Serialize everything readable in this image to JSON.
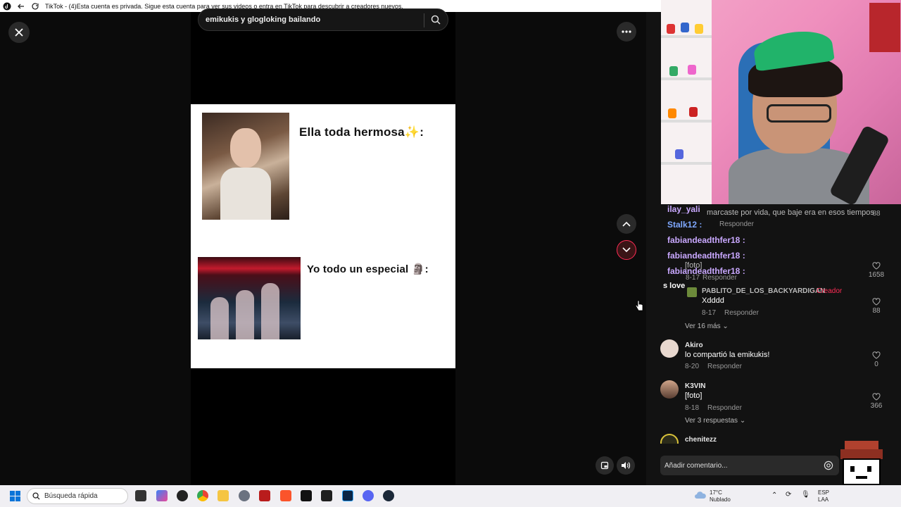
{
  "browser": {
    "title": "TikTok - (4)Esta cuenta es privada. Sigue esta cuenta para ver sus videos o entra en TikTok para descubrir a creadores nuevos."
  },
  "search": {
    "query": "emikukis y glogloking bailando"
  },
  "meme": {
    "caption_top": "Ella toda hermosa✨:",
    "caption_bottom": "Yo todo un especial 🗿:"
  },
  "chat_overlay": {
    "line0": "ilay_yali",
    "line0_text": "marcaste por vida, que baje era en esos tiempos",
    "line1_name": "Stalk12 :",
    "line1_reply": "Responder",
    "line2_name": "fabiandeadthfer18 :",
    "line3_name": "fabiandeadthfer18 :",
    "line3_text": "[foto]",
    "line4_name": "fabiandeadthfer18 :",
    "line4_reply": "Responder",
    "line4_date": "8-17",
    "likes_a": "88",
    "likes_b": "1658",
    "side_text": "s love"
  },
  "comments": [
    {
      "user": "PABLITO_DE_LOS_BACKYARDIGAN",
      "creator_tag": "· Creador",
      "text": "Xdddd",
      "date": "8-17",
      "reply": "Responder",
      "likes": "88",
      "more": "Ver 16 más"
    },
    {
      "user": "Akiro",
      "text": "lo compartió la emikukis!",
      "date": "8-20",
      "reply": "Responder",
      "likes": "0"
    },
    {
      "user": "K3VIN",
      "text": "[foto]",
      "date": "8-18",
      "reply": "Responder",
      "likes": "366",
      "more": "Ver 3 respuestas"
    },
    {
      "user": "chenitezz"
    }
  ],
  "comment_input": {
    "placeholder": "Añadir comentario..."
  },
  "taskbar": {
    "search_placeholder": "Búsqueda rápida",
    "weather_temp": "17°C",
    "weather_desc": "Nublado",
    "lang": "ESP",
    "lang_sub": "LAA"
  },
  "colors": {
    "accent": "#fe2c55",
    "chat_purple": "#c9a8ff",
    "chat_blue": "#7fa8ff"
  }
}
